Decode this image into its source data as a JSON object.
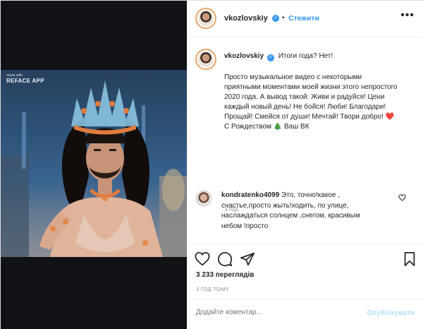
{
  "video": {
    "watermark_small": "made with",
    "watermark_big": "REFACE APP"
  },
  "header": {
    "username": "vkozlovskiy",
    "verified_mark": "✓",
    "separator": "•",
    "follow_label": "Стежити",
    "more_label": "•••"
  },
  "caption": {
    "username": "vkozlovskiy",
    "lead": "Итоги года? Нет!",
    "body": "Просто музыкальное видео с некоторыми приятными моментами моей жизни этого непростого 2020 года. А вывод такой: Живи и радуйся! Цени каждый новый день! Не бойся! Люби! Благодари! Прощай! Смейся от души! Мечтай! Твори добро! ❤️ С Рождеством 🎄 Ваш ВК",
    "ago": "3 год."
  },
  "comment": {
    "username": "kondratenko4099",
    "text": "Это, точно!какое , счастье,просто жыть!ходить, по улице, наслаждаться солнцем ,снегом, красивым небом !просто"
  },
  "actions": {
    "icons": [
      "heart-icon",
      "comment-icon",
      "share-icon",
      "bookmark-icon"
    ]
  },
  "likes": "3 233 переглядів",
  "timestamp": "3 ГОД ТОМУ",
  "add_comment": {
    "placeholder": "Додайте коментар...",
    "publish_label": "Опублікувати"
  },
  "colors": {
    "accent": "#3897f0",
    "publish_disabled": "#b2dffc",
    "muted": "#8e8e8e"
  }
}
